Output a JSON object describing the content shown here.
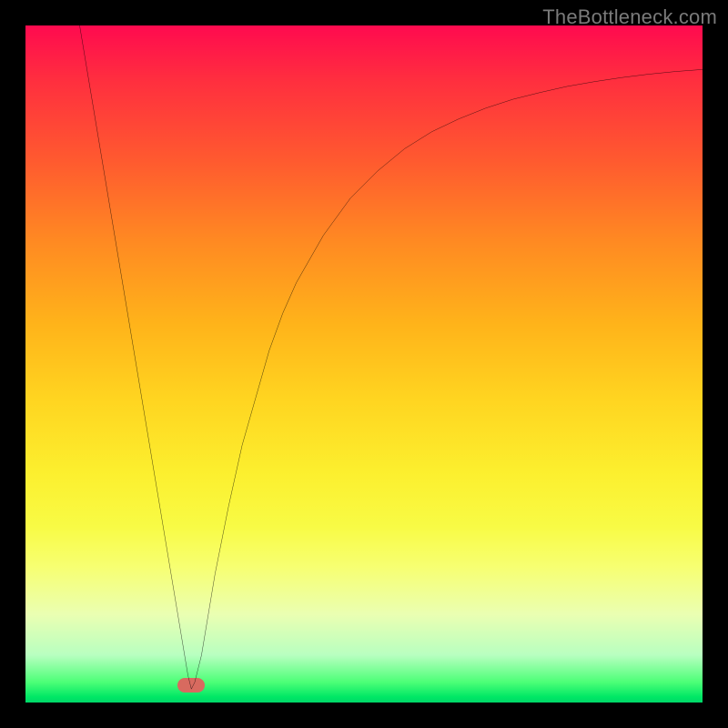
{
  "watermark": "TheBottleneck.com",
  "chart_data": {
    "type": "line",
    "title": "",
    "xlabel": "",
    "ylabel": "",
    "xlim": [
      0,
      100
    ],
    "ylim": [
      0,
      100
    ],
    "grid": false,
    "series": [
      {
        "name": "bottleneck-curve",
        "x": [
          8,
          10,
          12,
          14,
          16,
          18,
          20,
          22,
          23,
          24,
          24.5,
          25,
          26,
          27,
          28,
          30,
          32,
          34,
          36,
          38,
          40,
          44,
          48,
          52,
          56,
          60,
          64,
          68,
          72,
          76,
          80,
          84,
          88,
          92,
          96,
          100
        ],
        "y": [
          100,
          88,
          76,
          64,
          52,
          40,
          28,
          16,
          10,
          4,
          2,
          3,
          7,
          13,
          19,
          29,
          38,
          45,
          52,
          57.5,
          62,
          69,
          74.5,
          78.5,
          81.8,
          84.3,
          86.2,
          87.8,
          89.1,
          90.1,
          91.0,
          91.7,
          92.3,
          92.8,
          93.2,
          93.5
        ]
      }
    ],
    "annotations": [
      {
        "name": "min-marker",
        "x": 24.5,
        "y": 2.6,
        "color": "#d86a5f"
      }
    ],
    "background": {
      "type": "vertical-gradient",
      "stops": [
        {
          "pos": 0.0,
          "color": "#ff0a4f"
        },
        {
          "pos": 0.2,
          "color": "#ff5a2f"
        },
        {
          "pos": 0.44,
          "color": "#ffb31a"
        },
        {
          "pos": 0.66,
          "color": "#fcef2e"
        },
        {
          "pos": 0.87,
          "color": "#eaffb2"
        },
        {
          "pos": 1.0,
          "color": "#00d768"
        }
      ]
    }
  }
}
